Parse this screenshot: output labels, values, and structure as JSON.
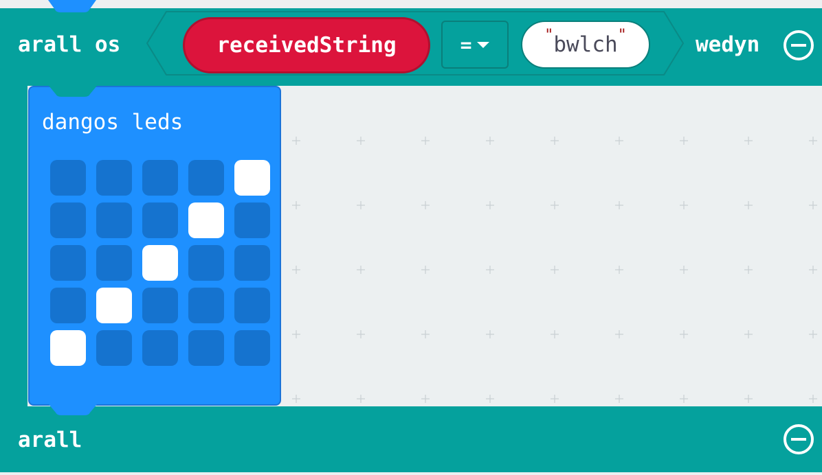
{
  "if_block": {
    "if_label": "arall os",
    "then_label": "wedyn",
    "else_label": "arall"
  },
  "condition": {
    "variable": "receivedString",
    "operator": "=",
    "string_value": "bwlch"
  },
  "leds_block": {
    "label": "dangos leds",
    "grid": [
      [
        0,
        0,
        0,
        0,
        1
      ],
      [
        0,
        0,
        0,
        1,
        0
      ],
      [
        0,
        0,
        1,
        0,
        0
      ],
      [
        0,
        1,
        0,
        0,
        0
      ],
      [
        1,
        0,
        0,
        0,
        0
      ]
    ]
  },
  "colors": {
    "logic_block": "#05a19d",
    "variable_block": "#dc143c",
    "basic_block": "#1e90ff",
    "led_off": "#1573cf",
    "led_on": "#ffffff",
    "workspace": "#ecf0f1"
  },
  "icons": {
    "remove_else": "minus-circle-icon",
    "remove_if": "minus-circle-icon",
    "dropdown": "chevron-down-icon"
  }
}
